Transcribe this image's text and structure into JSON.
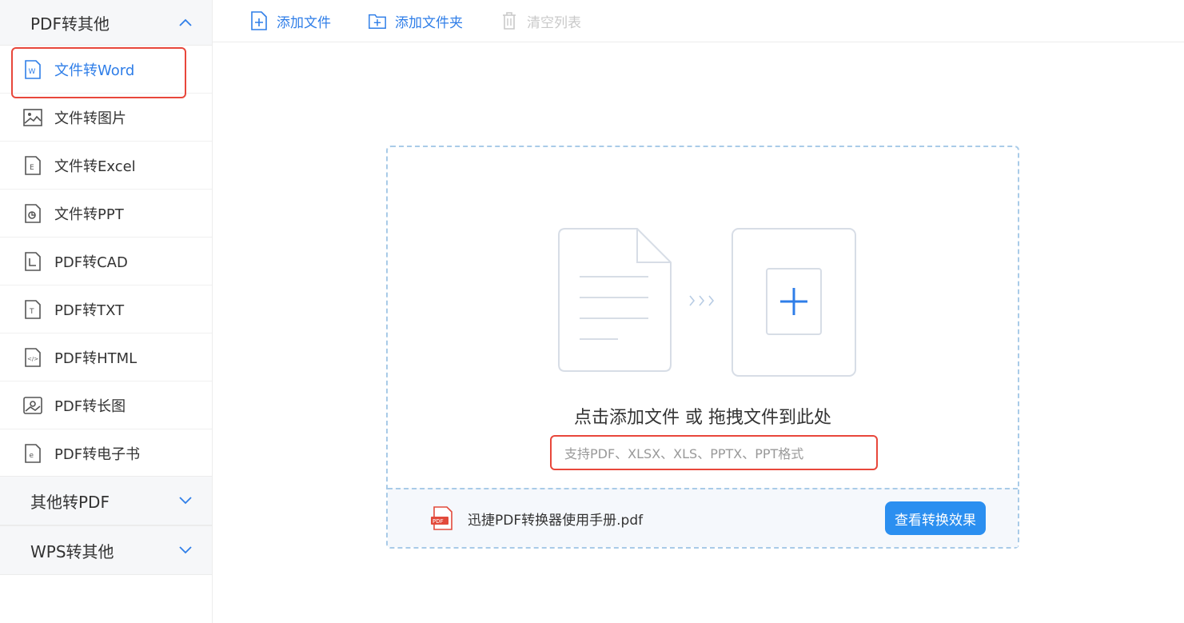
{
  "sidebar": {
    "group_pdf_to_other": "PDF转其他",
    "items": [
      {
        "label": "文件转Word",
        "icon": "word-file-icon"
      },
      {
        "label": "文件转图片",
        "icon": "image-file-icon"
      },
      {
        "label": "文件转Excel",
        "icon": "excel-file-icon"
      },
      {
        "label": "文件转PPT",
        "icon": "ppt-file-icon"
      },
      {
        "label": "PDF转CAD",
        "icon": "cad-file-icon"
      },
      {
        "label": "PDF转TXT",
        "icon": "txt-file-icon"
      },
      {
        "label": "PDF转HTML",
        "icon": "html-file-icon"
      },
      {
        "label": "PDF转长图",
        "icon": "long-image-icon"
      },
      {
        "label": "PDF转电子书",
        "icon": "ebook-file-icon"
      }
    ],
    "group_other_to_pdf": "其他转PDF",
    "group_wps_to_other": "WPS转其他"
  },
  "toolbar": {
    "add_file": "添加文件",
    "add_folder": "添加文件夹",
    "clear_list": "清空列表"
  },
  "dropzone": {
    "title": "点击添加文件 或 拖拽文件到此处",
    "formats": "支持PDF、XLSX、XLS、PPTX、PPT格式",
    "sample_file": "迅捷PDF转换器使用手册.pdf",
    "view_button": "查看转换效果"
  },
  "colors": {
    "accent": "#2f7ee8",
    "highlight_border": "#e8473b",
    "button_bg": "#2b8ff0"
  }
}
